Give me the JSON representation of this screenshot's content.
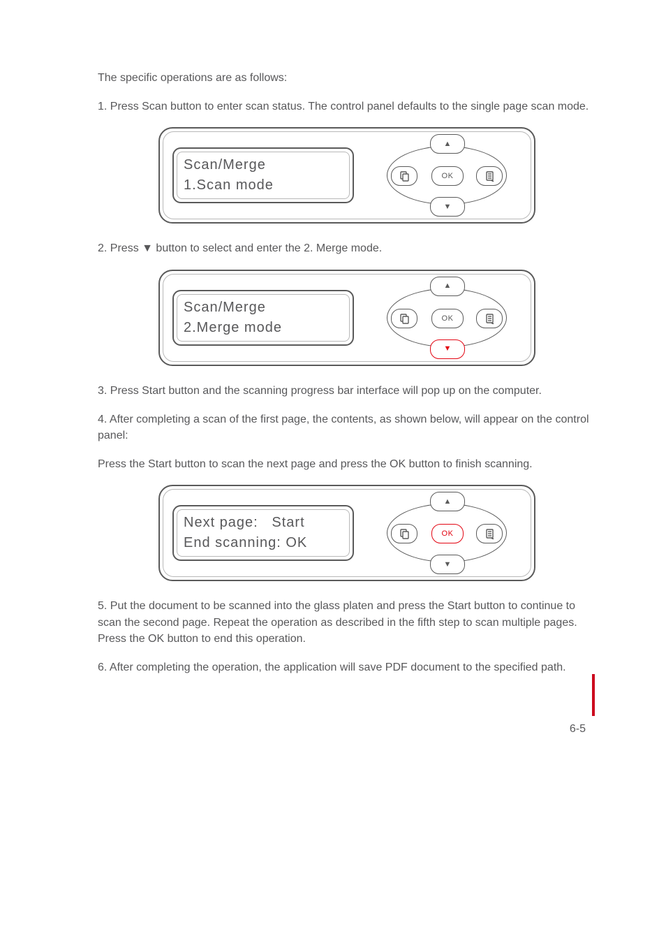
{
  "p_intro": "The specific operations are as follows:",
  "p1": "1. Press Scan button to enter scan status. The control panel defaults to the single page scan mode.",
  "p2_a": "2. Press ",
  "p2_b": " button to select and enter the 2. Merge mode.",
  "p3": "3. Press Start button and the scanning progress bar interface will pop up on the computer.",
  "p4": "4. After completing a scan of the first page, the contents, as shown below, will appear on the control panel:",
  "p_press": "Press the Start button to scan the next page and press the OK button to finish scanning.",
  "p5": "5. Put the document to be scanned into the glass platen and press the Start button to continue to scan the second page. Repeat the operation as described in the fifth step to scan multiple pages. Press the OK button to end this operation.",
  "p6": "6. After completing the operation, the application will save PDF document to the specified path.",
  "panel1": {
    "line1": "Scan/Merge",
    "line2": "1.Scan mode"
  },
  "panel2": {
    "line1": "Scan/Merge",
    "line2": "2.Merge mode"
  },
  "panel3": {
    "line1": "Next page:   Start",
    "line2": "End scanning: OK"
  },
  "ok_label": "OK",
  "glyph_up": "▲",
  "glyph_down": "▼",
  "page_number": "6-5"
}
